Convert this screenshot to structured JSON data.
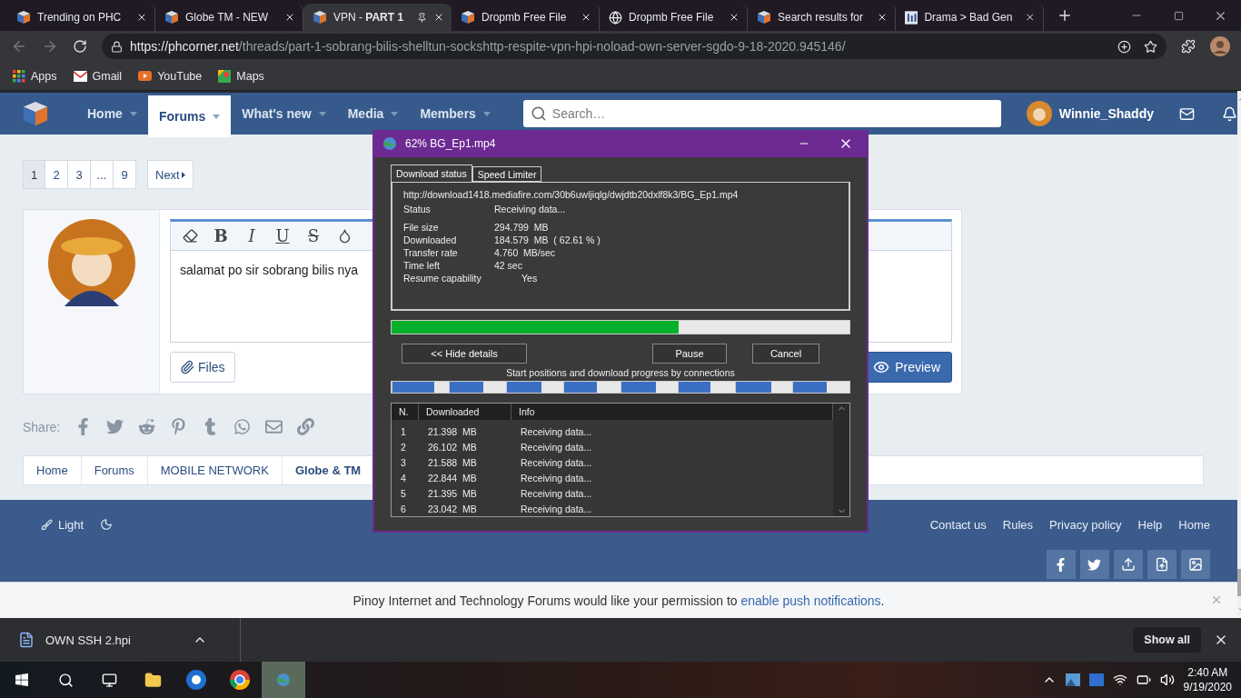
{
  "browser": {
    "tabs": [
      {
        "title": "Trending on PHC",
        "kind": "cube",
        "selected": false
      },
      {
        "title": "Globe TM - NEW",
        "kind": "cube",
        "selected": false
      },
      {
        "title": "VPN - **PART 1**",
        "kind": "cube",
        "selected": true
      },
      {
        "title": "Dropmb Free File",
        "kind": "cube",
        "selected": false
      },
      {
        "title": "Dropmb Free File",
        "kind": "globe",
        "selected": false
      },
      {
        "title": "Search results for",
        "kind": "cube",
        "selected": false
      },
      {
        "title": "Drama > Bad Gen",
        "kind": "bars",
        "selected": false
      }
    ],
    "url_host": "https://phcorner.net",
    "url_path": "/threads/part-1-sobrang-bilis-shelltun-sockshttp-respite-vpn-hpi-noload-own-server-sgdo-9-18-2020.945146/",
    "bookmarks": [
      {
        "label": "Apps",
        "kind": "apps"
      },
      {
        "label": "Gmail",
        "kind": "gmail"
      },
      {
        "label": "YouTube",
        "kind": "youtube"
      },
      {
        "label": "Maps",
        "kind": "maps"
      }
    ]
  },
  "nav": {
    "items": [
      {
        "label": "Home",
        "selected": false
      },
      {
        "label": "Forums",
        "selected": true
      },
      {
        "label": "What's new",
        "selected": false
      },
      {
        "label": "Media",
        "selected": false
      },
      {
        "label": "Members",
        "selected": false
      }
    ],
    "search_placeholder": "Search…",
    "user": "Winnie_Shaddy"
  },
  "pagination": {
    "pages": [
      {
        "label": "1",
        "selected": true
      },
      {
        "label": "2",
        "selected": false
      },
      {
        "label": "3",
        "selected": false
      },
      {
        "label": "...",
        "selected": false
      },
      {
        "label": "9",
        "selected": false
      }
    ],
    "next": "Next"
  },
  "editor": {
    "toolbar": [
      {
        "kind": "eraser"
      },
      {
        "kind": "bold",
        "label": "B"
      },
      {
        "kind": "italic",
        "label": "I"
      },
      {
        "kind": "underline",
        "label": "U"
      },
      {
        "kind": "strike",
        "label": "S"
      },
      {
        "kind": "color"
      }
    ],
    "text": "salamat po sir sobrang bilis nya",
    "files_button": "Files",
    "preview_button": "Preview"
  },
  "share": {
    "label": "Share:"
  },
  "breadcrumbs": [
    {
      "label": "Home",
      "current": false
    },
    {
      "label": "Forums",
      "current": false
    },
    {
      "label": "MOBILE NETWORK",
      "current": false
    },
    {
      "label": "Globe & TM",
      "current": true
    }
  ],
  "footer": {
    "style_label": "Light",
    "links": [
      "Contact us",
      "Rules",
      "Privacy policy",
      "Help",
      "Home"
    ]
  },
  "notification": {
    "text": "Pinoy Internet and Technology Forums would like your permission to ",
    "link": "enable push notifications",
    "end": "."
  },
  "dialog": {
    "title": "62% BG_Ep1.mp4",
    "tabs": [
      {
        "label": "Download status",
        "selected": true
      },
      {
        "label": "Speed Limiter",
        "selected": false
      }
    ],
    "url": "http://download1418.mediafire.com/30b6uwljiqlg/dwjdtb20dxlf8k3/BG_Ep1.mp4",
    "status": {
      "label": "Status",
      "value": "Receiving data..."
    },
    "fields": [
      {
        "label": "File size",
        "value": "294.799  MB"
      },
      {
        "label": "Downloaded",
        "value": "184.579  MB  ( 62.61 % )"
      },
      {
        "label": "Transfer rate",
        "value": "4.760  MB/sec"
      },
      {
        "label": "Time left",
        "value": "42 sec"
      },
      {
        "label": "Resume capability",
        "value": "Yes",
        "kind": "indent"
      }
    ],
    "progress": {
      "level": 0.626
    },
    "buttons": {
      "hide": "<< Hide details",
      "pause": "Pause",
      "cancel": "Cancel"
    },
    "connections_caption": "Start positions and download progress by connections",
    "connections": [
      {
        "level": 0.74
      },
      {
        "level": 0.6
      },
      {
        "level": 0.62
      },
      {
        "level": 0.58
      },
      {
        "level": 0.61
      },
      {
        "level": 0.57
      },
      {
        "level": 0.63
      },
      {
        "level": 0.59
      }
    ],
    "table": {
      "columns": [
        "N.",
        "Downloaded",
        "Info"
      ],
      "rows": [
        [
          "1",
          "21.398  MB",
          "Receiving data..."
        ],
        [
          "2",
          "26.102  MB",
          "Receiving data..."
        ],
        [
          "3",
          "21.588  MB",
          "Receiving data..."
        ],
        [
          "4",
          "22.844  MB",
          "Receiving data..."
        ],
        [
          "5",
          "21.395  MB",
          "Receiving data..."
        ],
        [
          "6",
          "23.042  MB",
          "Receiving data..."
        ]
      ]
    }
  },
  "download_shelf": {
    "file": "OWN SSH 2.hpi",
    "show_all": "Show all"
  },
  "taskbar": {
    "time": "2:40 AM",
    "date": "9/19/2020"
  }
}
